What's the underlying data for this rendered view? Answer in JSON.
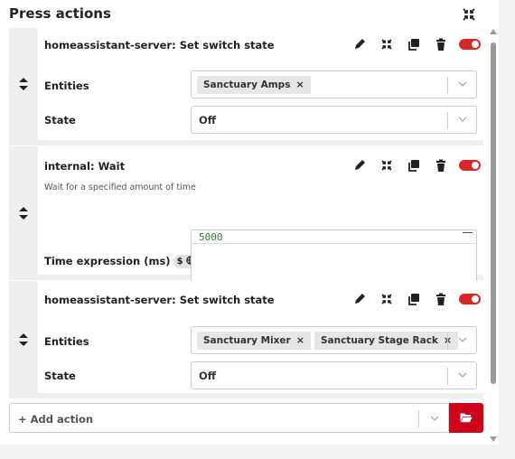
{
  "header": {
    "title": "Press actions",
    "collapse_icon": "collapse-arrows-icon"
  },
  "actions": [
    {
      "title": "homeassistant-server: Set switch state",
      "description": "",
      "enabled": true,
      "fields": {
        "entities_label": "Entities",
        "entities": [
          "Sanctuary Amps"
        ],
        "state_label": "State",
        "state_value": "Off"
      }
    },
    {
      "title": "internal: Wait",
      "description": "Wait for a specified amount of time",
      "enabled": true,
      "fields": {
        "time_label": "Time expression (ms)",
        "time_badge": "$",
        "time_value": "5000"
      }
    },
    {
      "title": "homeassistant-server: Set switch state",
      "description": "",
      "enabled": true,
      "fields": {
        "entities_label": "Entities",
        "entities": [
          "Sanctuary Mixer",
          "Sanctuary Stage Rack"
        ],
        "state_label": "State",
        "state_value": "Off"
      }
    }
  ],
  "chip_remove": "×",
  "footer": {
    "add_action_label": "+ Add action",
    "folder_icon": "folder-open-icon"
  },
  "colors": {
    "accent": "#d0021b",
    "toggle_on": "#d62626",
    "code_text": "#2e7d32"
  }
}
